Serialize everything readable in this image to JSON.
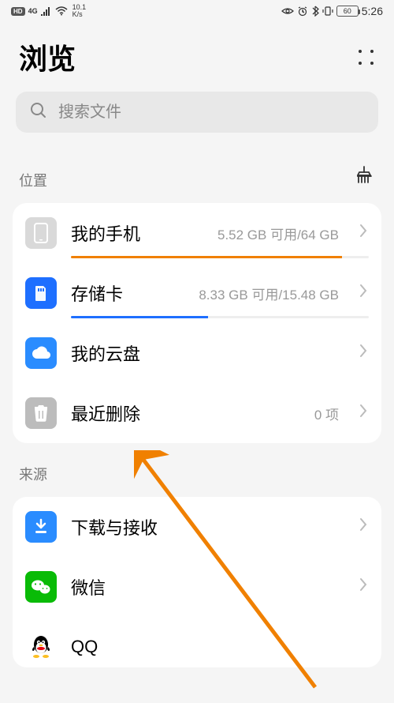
{
  "status_bar": {
    "hd_label": "HD",
    "net_type": "4G",
    "net_speed_top": "10.1",
    "net_speed_bottom": "K/s",
    "battery_label": "60",
    "time": "5:26"
  },
  "header": {
    "title": "浏览"
  },
  "search": {
    "placeholder": "搜索文件"
  },
  "sections": {
    "location": {
      "header": "位置",
      "items": [
        {
          "title": "我的手机",
          "meta": "5.52 GB 可用/64 GB",
          "progress": {
            "color": "#f08000",
            "percent": 91
          }
        },
        {
          "title": "存储卡",
          "meta": "8.33 GB 可用/15.48 GB",
          "progress": {
            "color": "#1e6fff",
            "percent": 46
          }
        },
        {
          "title": "我的云盘",
          "meta": ""
        },
        {
          "title": "最近删除",
          "meta": "0 项"
        }
      ]
    },
    "source": {
      "header": "来源",
      "items": [
        {
          "title": "下载与接收"
        },
        {
          "title": "微信"
        },
        {
          "title": "QQ"
        }
      ]
    }
  }
}
